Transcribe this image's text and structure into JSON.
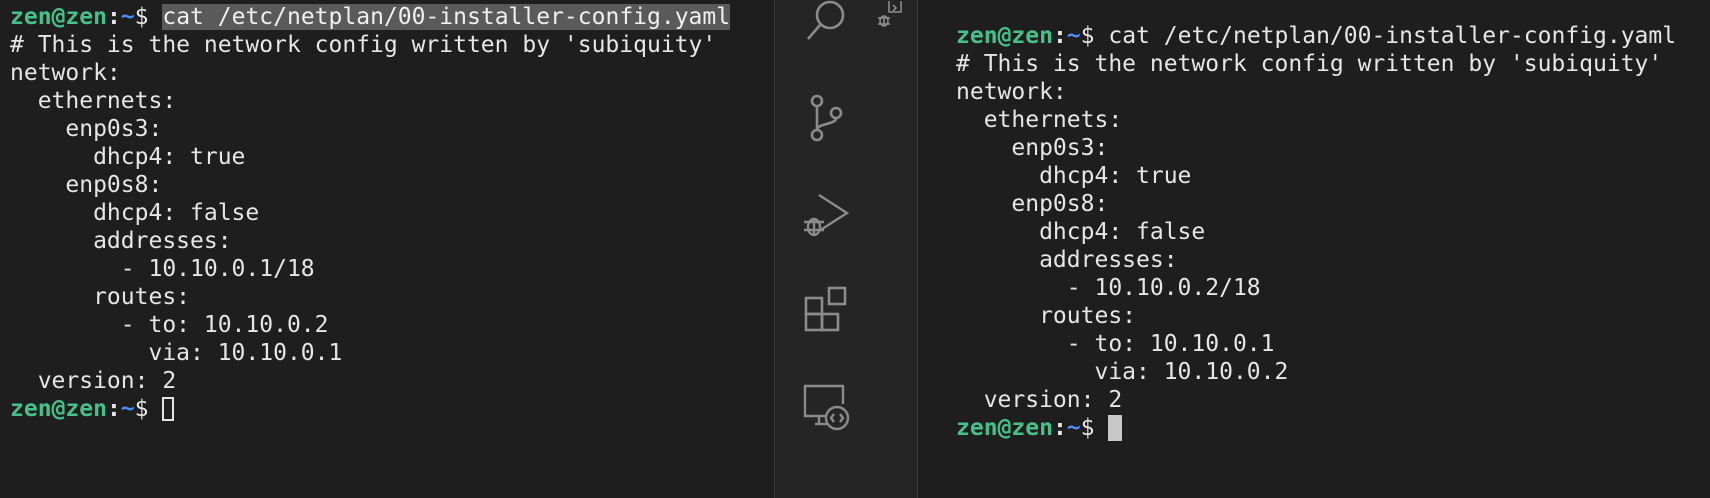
{
  "prompt": {
    "user": "zen@zen",
    "colon": ":",
    "path": "~",
    "dollar": "$ "
  },
  "left_terminal": {
    "command": "cat /etc/netplan/00-installer-config.yaml",
    "output": [
      "# This is the network config written by 'subiquity'",
      "network:",
      "  ethernets:",
      "    enp0s3:",
      "      dhcp4: true",
      "    enp0s8:",
      "      dhcp4: false",
      "      addresses:",
      "        - 10.10.0.1/18",
      "      routes:",
      "        - to: 10.10.0.2",
      "          via: 10.10.0.1",
      "  version: 2"
    ]
  },
  "right_terminal": {
    "command": "cat /etc/netplan/00-installer-config.yaml",
    "output": [
      "# This is the network config written by 'subiquity'",
      "network:",
      "  ethernets:",
      "    enp0s3:",
      "      dhcp4: true",
      "    enp0s8:",
      "      dhcp4: false",
      "      addresses:",
      "        - 10.10.0.2/18",
      "      routes:",
      "        - to: 10.10.0.1",
      "          via: 10.10.0.2",
      "  version: 2"
    ]
  },
  "activity_bar": {
    "icons": [
      "search-icon",
      "source-control-icon",
      "run-debug-icon",
      "extensions-icon",
      "remote-explorer-icon",
      "debug-console-icon"
    ],
    "icon_color": "#8b8b8b"
  },
  "colors": {
    "user_green": "#45c28a",
    "path_blue": "#4f8cff",
    "background": "#1e1e1e",
    "activity_bar_bg": "#252526"
  }
}
